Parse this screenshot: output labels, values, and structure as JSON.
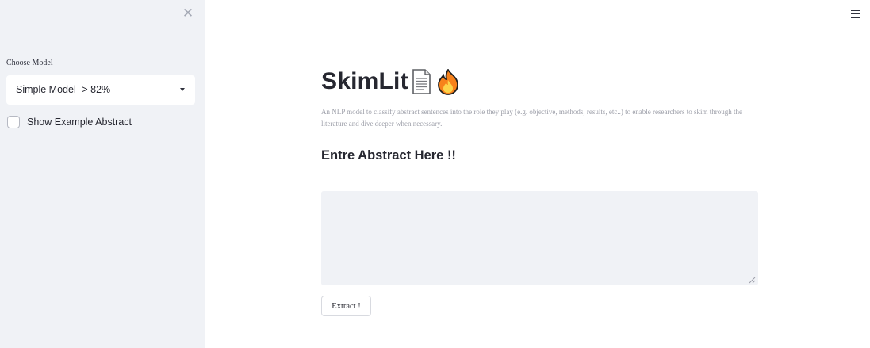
{
  "sidebar": {
    "close_icon": "close-icon",
    "model_label": "Choose Model",
    "model_select": {
      "value": "Simple Model -> 82%"
    },
    "example_checkbox": {
      "label": "Show Example Abstract",
      "checked": false
    }
  },
  "header": {
    "menu_icon": "hamburger-menu-icon"
  },
  "main": {
    "title": "SkimLit",
    "title_icons": [
      "document-icon",
      "fire-icon"
    ],
    "description": "An NLP model to classify abstract sentences into the role they play (e.g. objective, methods, results, etc..) to enable researchers to skim through the literature and dive deeper when necessary.",
    "subheading": "Entre Abstract Here !!",
    "abstract_input": {
      "value": "",
      "placeholder": ""
    },
    "extract_button": "Extract !"
  },
  "colors": {
    "sidebar_bg": "#f0f2f6",
    "textarea_bg": "#f0f2f6",
    "text": "#262730",
    "muted_text": "#9c9ea8"
  }
}
